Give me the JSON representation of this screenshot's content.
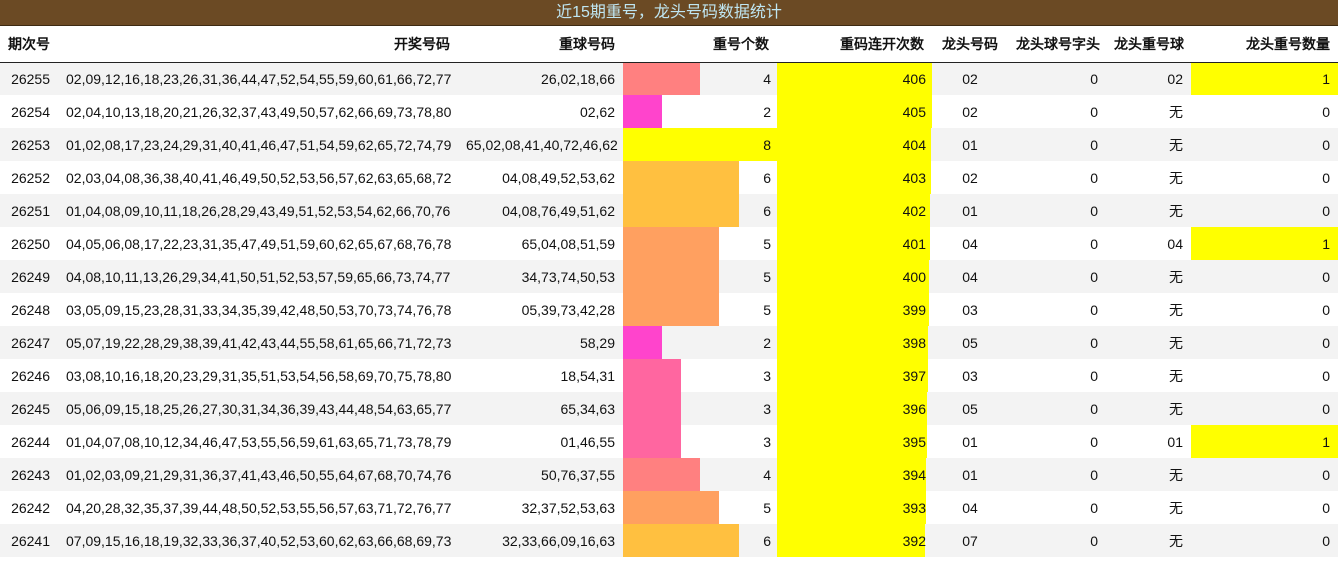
{
  "title": "近15期重号，龙头号码数据统计",
  "headers": {
    "period": "期次号",
    "numbers": "开奖号码",
    "repeat_balls": "重球号码",
    "repeat_count": "重号个数",
    "repeat_streak": "重码连开次数",
    "head_number": "龙头号码",
    "head_digit": "龙头球号字头",
    "head_repeat_ball": "龙头重号球",
    "head_repeat_qty": "龙头重号数量"
  },
  "colors": {
    "bar_2": "#ff44cc",
    "bar_3": "#ff66a0",
    "bar_4": "#ff8080",
    "bar_5": "#ffa060",
    "bar_6": "#ffc040",
    "bar_8": "#ffff00",
    "highlight": "#ffff00"
  },
  "rows": [
    {
      "period": "26255",
      "numbers": "02,09,12,16,18,23,26,31,36,44,47,52,54,55,59,60,61,66,72,77",
      "repeat_balls": "26,02,18,66",
      "repeat_count": 4,
      "repeat_count_text": "4",
      "streak": "406",
      "head": "02",
      "head_digit": "0",
      "head_repeat": "02",
      "head_qty": "1",
      "highlight": true
    },
    {
      "period": "26254",
      "numbers": "02,04,10,13,18,20,21,26,32,37,43,49,50,57,62,66,69,73,78,80",
      "repeat_balls": "02,62",
      "repeat_count": 2,
      "repeat_count_text": "2",
      "streak": "405",
      "head": "02",
      "head_digit": "0",
      "head_repeat": "无",
      "head_qty": "0",
      "highlight": false
    },
    {
      "period": "26253",
      "numbers": "01,02,08,17,23,24,29,31,40,41,46,47,51,54,59,62,65,72,74,79",
      "repeat_balls": "65,02,08,41,40,72,46,62",
      "repeat_count": 8,
      "repeat_count_text": "8",
      "streak": "404",
      "head": "01",
      "head_digit": "0",
      "head_repeat": "无",
      "head_qty": "0",
      "highlight": false
    },
    {
      "period": "26252",
      "numbers": "02,03,04,08,36,38,40,41,46,49,50,52,53,56,57,62,63,65,68,72",
      "repeat_balls": "04,08,49,52,53,62",
      "repeat_count": 6,
      "repeat_count_text": "6",
      "streak": "403",
      "head": "02",
      "head_digit": "0",
      "head_repeat": "无",
      "head_qty": "0",
      "highlight": false
    },
    {
      "period": "26251",
      "numbers": "01,04,08,09,10,11,18,26,28,29,43,49,51,52,53,54,62,66,70,76",
      "repeat_balls": "04,08,76,49,51,62",
      "repeat_count": 6,
      "repeat_count_text": "6",
      "streak": "402",
      "head": "01",
      "head_digit": "0",
      "head_repeat": "无",
      "head_qty": "0",
      "highlight": false
    },
    {
      "period": "26250",
      "numbers": "04,05,06,08,17,22,23,31,35,47,49,51,59,60,62,65,67,68,76,78",
      "repeat_balls": "65,04,08,51,59",
      "repeat_count": 5,
      "repeat_count_text": "5",
      "streak": "401",
      "head": "04",
      "head_digit": "0",
      "head_repeat": "04",
      "head_qty": "1",
      "highlight": true
    },
    {
      "period": "26249",
      "numbers": "04,08,10,11,13,26,29,34,41,50,51,52,53,57,59,65,66,73,74,77",
      "repeat_balls": "34,73,74,50,53",
      "repeat_count": 5,
      "repeat_count_text": "5",
      "streak": "400",
      "head": "04",
      "head_digit": "0",
      "head_repeat": "无",
      "head_qty": "0",
      "highlight": false
    },
    {
      "period": "26248",
      "numbers": "03,05,09,15,23,28,31,33,34,35,39,42,48,50,53,70,73,74,76,78",
      "repeat_balls": "05,39,73,42,28",
      "repeat_count": 5,
      "repeat_count_text": "5",
      "streak": "399",
      "head": "03",
      "head_digit": "0",
      "head_repeat": "无",
      "head_qty": "0",
      "highlight": false
    },
    {
      "period": "26247",
      "numbers": "05,07,19,22,28,29,38,39,41,42,43,44,55,58,61,65,66,71,72,73",
      "repeat_balls": "58,29",
      "repeat_count": 2,
      "repeat_count_text": "2",
      "streak": "398",
      "head": "05",
      "head_digit": "0",
      "head_repeat": "无",
      "head_qty": "0",
      "highlight": false
    },
    {
      "period": "26246",
      "numbers": "03,08,10,16,18,20,23,29,31,35,51,53,54,56,58,69,70,75,78,80",
      "repeat_balls": "18,54,31",
      "repeat_count": 3,
      "repeat_count_text": "3",
      "streak": "397",
      "head": "03",
      "head_digit": "0",
      "head_repeat": "无",
      "head_qty": "0",
      "highlight": false
    },
    {
      "period": "26245",
      "numbers": "05,06,09,15,18,25,26,27,30,31,34,36,39,43,44,48,54,63,65,77",
      "repeat_balls": "65,34,63",
      "repeat_count": 3,
      "repeat_count_text": "3",
      "streak": "396",
      "head": "05",
      "head_digit": "0",
      "head_repeat": "无",
      "head_qty": "0",
      "highlight": false
    },
    {
      "period": "26244",
      "numbers": "01,04,07,08,10,12,34,46,47,53,55,56,59,61,63,65,71,73,78,79",
      "repeat_balls": "01,46,55",
      "repeat_count": 3,
      "repeat_count_text": "3",
      "streak": "395",
      "head": "01",
      "head_digit": "0",
      "head_repeat": "01",
      "head_qty": "1",
      "highlight": true
    },
    {
      "period": "26243",
      "numbers": "01,02,03,09,21,29,31,36,37,41,43,46,50,55,64,67,68,70,74,76",
      "repeat_balls": "50,76,37,55",
      "repeat_count": 4,
      "repeat_count_text": "4",
      "streak": "394",
      "head": "01",
      "head_digit": "0",
      "head_repeat": "无",
      "head_qty": "0",
      "highlight": false
    },
    {
      "period": "26242",
      "numbers": "04,20,28,32,35,37,39,44,48,50,52,53,55,56,57,63,71,72,76,77",
      "repeat_balls": "32,37,52,53,63",
      "repeat_count": 5,
      "repeat_count_text": "5",
      "streak": "393",
      "head": "04",
      "head_digit": "0",
      "head_repeat": "无",
      "head_qty": "0",
      "highlight": false
    },
    {
      "period": "26241",
      "numbers": "07,09,15,16,18,19,32,33,36,37,40,52,53,60,62,63,66,68,69,73",
      "repeat_balls": "32,33,66,09,16,63",
      "repeat_count": 6,
      "repeat_count_text": "6",
      "streak": "392",
      "head": "07",
      "head_digit": "0",
      "head_repeat": "无",
      "head_qty": "0",
      "highlight": false
    }
  ]
}
